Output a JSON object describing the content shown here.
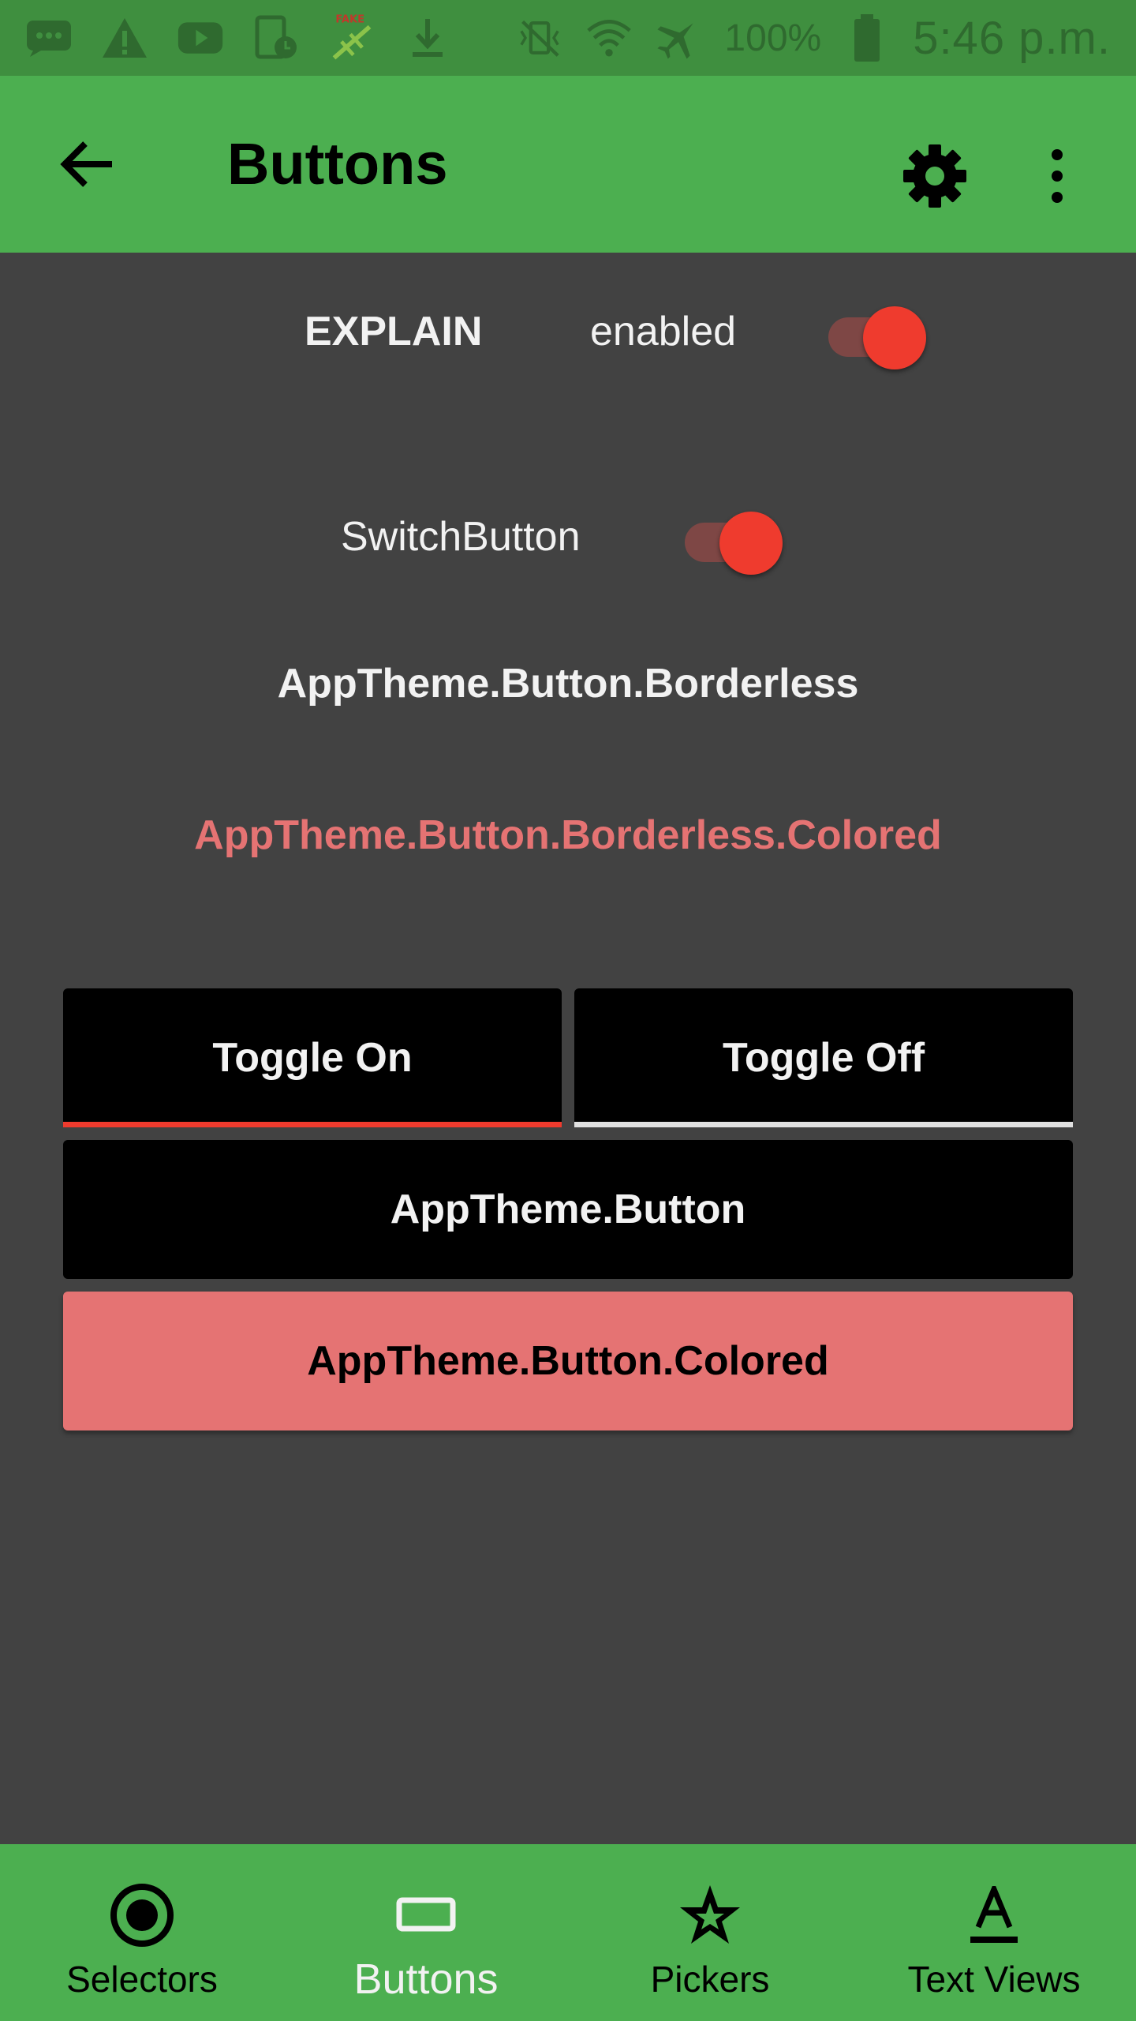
{
  "status_bar": {
    "battery": "100%",
    "time": "5:46 p.m."
  },
  "toolbar": {
    "title": "Buttons"
  },
  "explain_row": {
    "explain_label": "EXPLAIN",
    "enabled_label": "enabled",
    "switch_on": true
  },
  "switch_row": {
    "label": "SwitchButton",
    "switch_on": true
  },
  "buttons": {
    "borderless": "AppTheme.Button.Borderless",
    "borderless_colored": "AppTheme.Button.Borderless.Colored",
    "toggle_on": "Toggle On",
    "toggle_off": "Toggle Off",
    "app_button": "AppTheme.Button",
    "app_button_colored": "AppTheme.Button.Colored"
  },
  "bottom_nav": {
    "items": [
      {
        "label": "Selectors",
        "icon": "radio-button-icon"
      },
      {
        "label": "Buttons",
        "icon": "button-outline-icon",
        "active": true
      },
      {
        "label": "Pickers",
        "icon": "star-icon"
      },
      {
        "label": "Text Views",
        "icon": "text-format-icon"
      }
    ]
  },
  "colors": {
    "primary": "#4caf50",
    "primary_dark": "#3f8f3f",
    "accent": "#ef3b2e",
    "colored_button": "#e57373",
    "background": "#424242"
  }
}
